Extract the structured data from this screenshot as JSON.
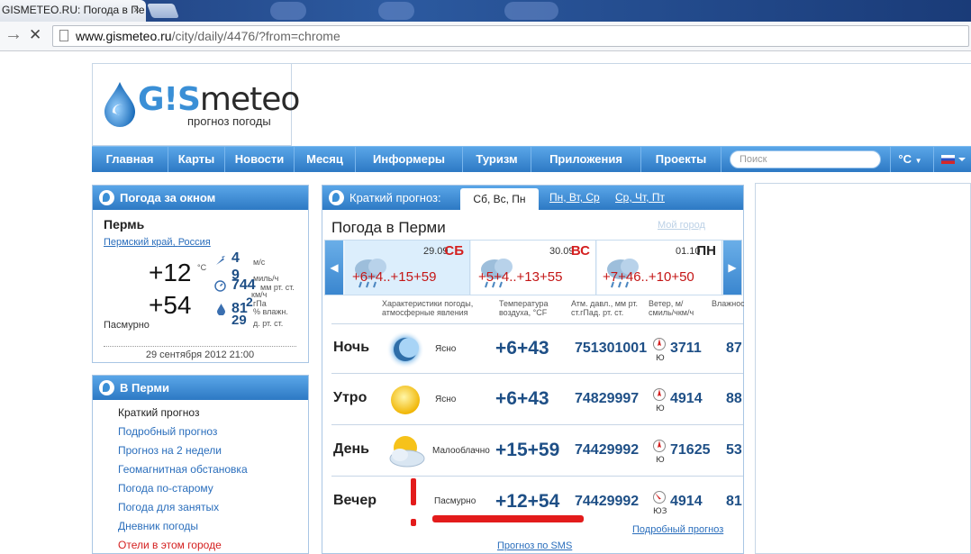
{
  "browser": {
    "tab_title": "GISMETEO.RU: Погода в Пе",
    "tab_close": "×",
    "url_host": "www.gismeteo.ru",
    "url_path": "/city/daily/4476/?from=chrome",
    "back": "→",
    "stop": "✕"
  },
  "logo": {
    "brand_prefix": "G!S",
    "brand_suffix": "meteo",
    "tagline": "прогноз погоды"
  },
  "nav": {
    "items": [
      "Главная",
      "Карты",
      "Новости",
      "Месяц",
      "Информеры",
      "Туризм",
      "Приложения",
      "Проекты"
    ],
    "search_placeholder": "Поиск",
    "unit": "°C"
  },
  "now_panel": {
    "title": "Погода за окном",
    "city": "Пермь",
    "region_1": "Пермский край",
    "region_sep": ", ",
    "region_2": "Россия",
    "temp_c": "+12",
    "temp_c_unit": "°C",
    "temp_f": "+54",
    "temp_f_unit": "°F",
    "desc": "Пасмурно",
    "wind": "4",
    "wind_unit": "м/с",
    "wind2": "9",
    "wind2_unit": "миль/ч",
    "pressure": "744",
    "pressure_unit": "мм рт. ст.",
    "pressure2_unit": "км/ч",
    "pressure_hpa": "2",
    "pressure_hpa_unit": "гПа",
    "humidity": "81",
    "humidity_unit": "% влажн.",
    "pressure3": "29",
    "pressure3_unit": "д. рт. ст.",
    "datetime": "29 сентября 2012 21:00"
  },
  "city_menu": {
    "title": "В Перми",
    "items": [
      "Краткий прогноз",
      "Подробный прогноз",
      "Прогноз на 2 недели",
      "Геомагнитная обстановка",
      "Погода по-старому",
      "Погода для занятых",
      "Дневник погоды",
      "Отели в этом городе"
    ]
  },
  "forecast": {
    "header_label": "Краткий прогноз:",
    "tabs": [
      "Сб, Вс, Пн",
      "Пн, Вт, Ср",
      "Ср, Чт, Пт"
    ],
    "city_title": "Погода в Перми",
    "my_city": "Мой город",
    "arrow_left": "◀",
    "arrow_right": "▶",
    "days": [
      {
        "date": "29.09",
        "day": "СБ",
        "temps": "+6+4..+15+59",
        "day_color": "#d41f1f"
      },
      {
        "date": "30.09",
        "day": "ВС",
        "temps": "+5+4..+13+55",
        "day_color": "#d41f1f"
      },
      {
        "date": "01.10",
        "day": "ПН",
        "temps": "+7+46..+10+50",
        "day_color": "#222222"
      }
    ],
    "columns": [
      "Характеристики погоды, атмосферные явления",
      "Температура воздуха, °CF",
      "Атм. давл., мм рт. ст.гПад. рт. ст.",
      "Ветер, м/ смиль/чкм/ч",
      "Влажнос"
    ],
    "rows": [
      {
        "name": "Ночь",
        "desc": "Ясно",
        "temp": "+6+43",
        "press": "751301001",
        "wind_dir": "Ю",
        "wind": "3711",
        "hum": "87"
      },
      {
        "name": "Утро",
        "desc": "Ясно",
        "temp": "+6+43",
        "press": "74829997",
        "wind_dir": "Ю",
        "wind": "4914",
        "hum": "88"
      },
      {
        "name": "День",
        "desc": "Малооблачно",
        "temp": "+15+59",
        "press": "74429992",
        "wind_dir": "Ю",
        "wind": "71625",
        "hum": "53"
      },
      {
        "name": "Вечер",
        "desc": "Пасмурно",
        "temp": "+12+54",
        "press": "74429992",
        "wind_dir": "ЮЗ",
        "wind": "4914",
        "hum": "81"
      }
    ],
    "detailed_link": "Подробный прогноз",
    "sms_link": "Прогноз по SMS"
  },
  "colors": {
    "nav_blue": "#2d79c4",
    "accent_red": "#e31b1b",
    "value_blue": "#1e4f86"
  }
}
